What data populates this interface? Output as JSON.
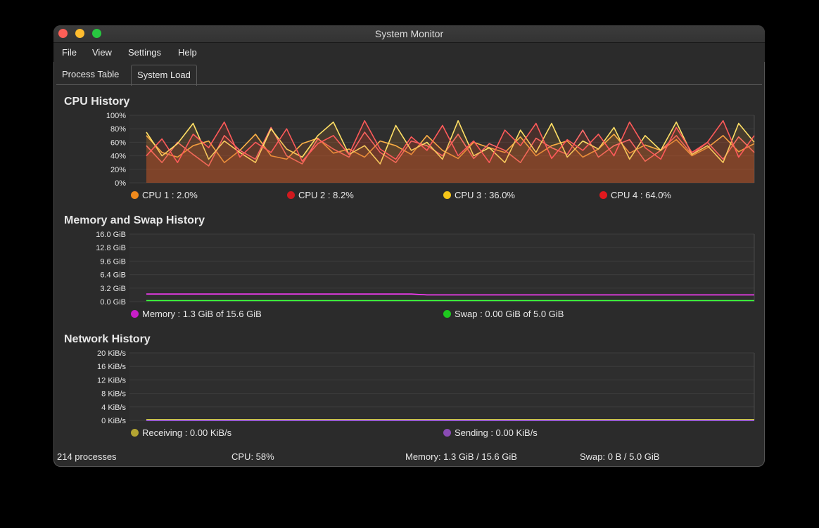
{
  "window": {
    "title": "System Monitor"
  },
  "menu": [
    "File",
    "View",
    "Settings",
    "Help"
  ],
  "tabs": [
    {
      "label": "Process Table",
      "active": false
    },
    {
      "label": "System Load",
      "active": true
    }
  ],
  "cpu": {
    "title": "CPU History",
    "y_ticks": [
      "100%",
      "80%",
      "60%",
      "40%",
      "20%",
      "0%"
    ],
    "legend": [
      {
        "label": "CPU 1 : 2.0%",
        "color": "#f08a1c"
      },
      {
        "label": "CPU 2 : 8.2%",
        "color": "#d0191e"
      },
      {
        "label": "CPU 3 : 36.0%",
        "color": "#f5c518"
      },
      {
        "label": "CPU 4 : 64.0%",
        "color": "#e0191e"
      }
    ]
  },
  "memory": {
    "title": "Memory and Swap History",
    "y_ticks": [
      "16.0 GiB",
      "12.8 GiB",
      "9.6 GiB",
      "6.4 GiB",
      "3.2 GiB",
      "0.0 GiB"
    ],
    "legend": [
      {
        "label": "Memory : 1.3 GiB of 15.6 GiB",
        "color": "#c81ec8"
      },
      {
        "label": "Swap : 0.00 GiB of 5.0 GiB",
        "color": "#1ec81e"
      }
    ]
  },
  "network": {
    "title": "Network History",
    "y_ticks": [
      "20 KiB/s",
      "16 KiB/s",
      "12 KiB/s",
      "8 KiB/s",
      "4 KiB/s",
      "0 KiB/s"
    ],
    "legend": [
      {
        "label": "Receiving : 0.00 KiB/s",
        "color": "#b4a532"
      },
      {
        "label": "Sending : 0.00 KiB/s",
        "color": "#8a4bb4"
      }
    ]
  },
  "status": {
    "processes": "214 processes",
    "cpu": "CPU: 58%",
    "memory": "Memory: 1.3 GiB / 15.6 GiB",
    "swap": "Swap: 0 B / 5.0 GiB"
  },
  "colors": {
    "memory_line": "#ff3cff",
    "swap_line": "#3cff3c",
    "receiving_line": "#ffff3c",
    "sending_line": "#a050ff"
  },
  "chart_data": [
    {
      "type": "line",
      "title": "CPU History",
      "y_unit": "%",
      "ylim": [
        0,
        100
      ],
      "series": [
        {
          "name": "CPU 1",
          "values": [
            70,
            45,
            38,
            55,
            62,
            30,
            48,
            72,
            40,
            35,
            58,
            66,
            44,
            50,
            38,
            62,
            55,
            42,
            70,
            48,
            36,
            60,
            52,
            45,
            68,
            40,
            55,
            62,
            38,
            50,
            72,
            44,
            56,
            48,
            64,
            40,
            52,
            70,
            46,
            58
          ]
        },
        {
          "name": "CPU 2",
          "values": [
            55,
            30,
            60,
            42,
            25,
            70,
            48,
            35,
            82,
            40,
            28,
            65,
            50,
            38,
            75,
            45,
            30,
            62,
            55,
            40,
            72,
            36,
            58,
            48,
            30,
            66,
            52,
            42,
            78,
            38,
            55,
            64,
            32,
            48,
            70,
            42,
            60,
            35,
            68,
            45
          ]
        },
        {
          "name": "CPU 3",
          "values": [
            75,
            40,
            58,
            88,
            35,
            62,
            45,
            30,
            80,
            50,
            38,
            70,
            90,
            42,
            55,
            28,
            85,
            48,
            60,
            35,
            92,
            40,
            52,
            30,
            78,
            45,
            88,
            38,
            62,
            50,
            82,
            35,
            70,
            48,
            90,
            42,
            55,
            30,
            88,
            60
          ]
        },
        {
          "name": "CPU 4",
          "values": [
            40,
            65,
            30,
            72,
            52,
            90,
            38,
            60,
            45,
            80,
            32,
            58,
            70,
            42,
            92,
            50,
            35,
            68,
            48,
            85,
            40,
            62,
            30,
            78,
            55,
            88,
            36,
            64,
            48,
            72,
            40,
            90,
            52,
            35,
            82,
            45,
            60,
            92,
            38,
            70
          ]
        }
      ]
    },
    {
      "type": "line",
      "title": "Memory and Swap History",
      "y_unit": "GiB",
      "ylim": [
        0,
        16
      ],
      "series": [
        {
          "name": "Memory",
          "values": [
            1.8,
            1.8,
            1.8,
            1.8,
            1.8,
            1.8,
            1.8,
            1.8,
            1.8,
            1.8,
            1.8,
            1.8,
            1.8,
            1.8,
            1.8,
            1.8,
            1.8,
            1.8,
            1.6,
            1.6,
            1.6,
            1.6,
            1.6,
            1.6,
            1.6,
            1.6,
            1.6,
            1.6,
            1.6,
            1.6,
            1.6,
            1.6,
            1.6,
            1.6,
            1.6,
            1.6,
            1.6,
            1.6,
            1.6,
            1.6
          ]
        },
        {
          "name": "Swap",
          "values": [
            0.25,
            0.25,
            0.25,
            0.25,
            0.25,
            0.25,
            0.25,
            0.25,
            0.25,
            0.25,
            0.25,
            0.25,
            0.25,
            0.25,
            0.25,
            0.25,
            0.25,
            0.25,
            0.25,
            0.25,
            0.25,
            0.25,
            0.25,
            0.25,
            0.25,
            0.25,
            0.25,
            0.25,
            0.25,
            0.25,
            0.25,
            0.25,
            0.25,
            0.25,
            0.25,
            0.25,
            0.25,
            0.25,
            0.25,
            0.25
          ]
        }
      ]
    },
    {
      "type": "line",
      "title": "Network History",
      "y_unit": "KiB/s",
      "ylim": [
        0,
        20
      ],
      "series": [
        {
          "name": "Receiving",
          "values": [
            0.2,
            0.2,
            0.2,
            0.2,
            0.2,
            0.2,
            0.2,
            0.2,
            0.2,
            0.2,
            0.2,
            0.2,
            0.2,
            0.2,
            0.2,
            0.2,
            0.2,
            0.2,
            0.2,
            0.2,
            0.2,
            0.2,
            0.2,
            0.2,
            0.2,
            0.2,
            0.2,
            0.2,
            0.2,
            0.2,
            0.2,
            0.2,
            0.2,
            0.2,
            0.2,
            0.2,
            0.2,
            0.2,
            0.2,
            0.2
          ]
        },
        {
          "name": "Sending",
          "values": [
            0,
            0,
            0,
            0,
            0,
            0,
            0,
            0,
            0,
            0,
            0,
            0,
            0,
            0,
            0,
            0,
            0,
            0,
            0,
            0,
            0,
            0,
            0,
            0,
            0,
            0,
            0,
            0,
            0,
            0,
            0,
            0,
            0,
            0,
            0,
            0,
            0,
            0,
            0,
            0
          ]
        }
      ]
    }
  ]
}
